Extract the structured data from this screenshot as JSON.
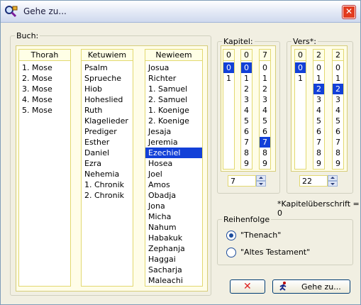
{
  "window": {
    "title": "Gehe zu...",
    "close_label": "✕"
  },
  "books": {
    "legend": "Buch:",
    "columns": [
      {
        "header": "Thorah",
        "items": [
          "1. Mose",
          "2. Mose",
          "3. Mose",
          "4. Mose",
          "5. Mose"
        ],
        "selected": null
      },
      {
        "header": "Ketuwiem",
        "items": [
          "Psalm",
          "Sprueche",
          "Hiob",
          "Hoheslied",
          "Ruth",
          "Klagelieder",
          "Prediger",
          "Esther",
          "Daniel",
          "Ezra",
          "Nehemia",
          "1. Chronik",
          "2. Chronik"
        ],
        "selected": null
      },
      {
        "header": "Newieem",
        "items": [
          "Josua",
          "Richter",
          "1. Samuel",
          "2. Samuel",
          "1. Koenige",
          "2. Koenige",
          "Jesaja",
          "Jeremia",
          "Ezechiel",
          "Hosea",
          "Joel",
          "Amos",
          "Obadja",
          "Jona",
          "Micha",
          "Nahum",
          "Habakuk",
          "Zephanja",
          "Haggai",
          "Sacharja",
          "Maleachi"
        ],
        "selected": 8
      }
    ]
  },
  "kapitel": {
    "legend": "Kapitel:",
    "columns": [
      {
        "header": "0",
        "items": [
          "0",
          "1"
        ],
        "selected": 0
      },
      {
        "header": "0",
        "items": [
          "0",
          "1",
          "2",
          "3",
          "4",
          "5",
          "6",
          "7",
          "8",
          "9"
        ],
        "selected": 0
      },
      {
        "header": "7",
        "items": [
          "0",
          "1",
          "2",
          "3",
          "4",
          "5",
          "6",
          "7",
          "8",
          "9"
        ],
        "selected": 7
      }
    ],
    "value": "7"
  },
  "vers": {
    "legend": "Vers*:",
    "columns": [
      {
        "header": "0",
        "items": [
          "0",
          "1"
        ],
        "selected": 0
      },
      {
        "header": "2",
        "items": [
          "0",
          "1",
          "2",
          "3",
          "4",
          "5",
          "6",
          "7",
          "8",
          "9"
        ],
        "selected": 2
      },
      {
        "header": "2",
        "items": [
          "0",
          "1",
          "2",
          "3",
          "4",
          "5",
          "6",
          "7",
          "8",
          "9"
        ],
        "selected": 2
      }
    ],
    "value": "22"
  },
  "note": "*Kapitelüberschrift = 0",
  "order": {
    "legend": "Reihenfolge",
    "options": [
      {
        "label": "\"Thenach\"",
        "checked": true
      },
      {
        "label": "\"Altes Testament\"",
        "checked": false
      }
    ]
  },
  "buttons": {
    "cancel_icon": "✕",
    "goto_label": "Gehe zu..."
  },
  "icons": {
    "app": "search-book-icon",
    "cancel": "red-x-icon",
    "goto": "running-man-icon"
  }
}
